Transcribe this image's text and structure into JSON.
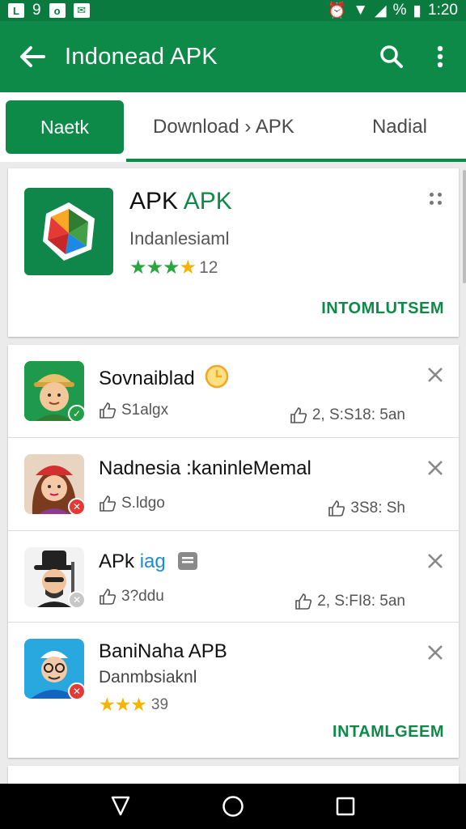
{
  "status_bar": {
    "left_items": [
      "9"
    ],
    "battery_percent": "%",
    "time": "1:20"
  },
  "app_bar": {
    "title": "Indonead APK"
  },
  "tabs": [
    {
      "label": "Naetk",
      "active": true
    },
    {
      "label": "Download › APK",
      "active": false
    },
    {
      "label": "Nadial",
      "active": false
    }
  ],
  "featured": {
    "title_primary": "APK",
    "title_accent": "APK",
    "subtitle": "Indanlesiaml",
    "rating_count": "12",
    "stars": 4,
    "install_label": "INTOMLUTSEM"
  },
  "list": [
    {
      "title": "Sovnaiblad",
      "meta": "S1algx",
      "stat": "2, S:S18: 5an",
      "badge_color": "#23a047"
    },
    {
      "title": "Nadnesia :kaninleMemal",
      "meta": "S.ldgo",
      "stat": "3S8: Sh",
      "badge_color": "#e53935"
    },
    {
      "title_primary": "APk",
      "title_accent": "iag",
      "meta": "3?ddu",
      "stat": "2, S:FI8: 5an",
      "badge_color": "#c7c7c7"
    },
    {
      "title": "BaniNaha APB",
      "subtitle": "Danmbsiaknl",
      "rating_count": "39",
      "stars": 3,
      "install_label": "INTAMLGEEM",
      "badge_color": "#e53935"
    }
  ],
  "colors": {
    "primary": "#0d8a47",
    "primary_dark": "#0a7a3e",
    "star": "#2aa63f",
    "star_yellow": "#f5b400"
  },
  "icons": [
    "back-arrow-icon",
    "search-icon",
    "overflow-menu-icon",
    "close-icon",
    "thumbs-up-icon",
    "star-icon",
    "nav-back-icon",
    "nav-home-icon",
    "nav-recents-icon"
  ]
}
